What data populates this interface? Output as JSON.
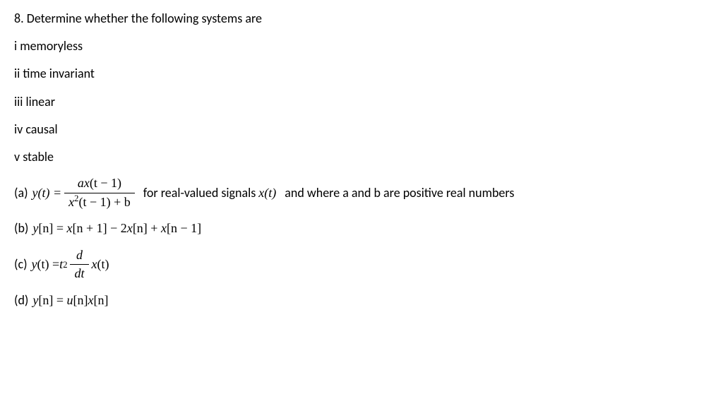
{
  "question": {
    "number": "8.",
    "prompt": "Determine whether the following systems are"
  },
  "properties": {
    "i": "i memoryless",
    "ii": "ii time invariant",
    "iii": "iii linear",
    "iv": "iv causal",
    "v": "v stable"
  },
  "parts": {
    "a": {
      "label": "(a)",
      "lhs": "y(t) =",
      "numerator_a": "ax",
      "numerator_paren": "(t − 1)",
      "denominator_x": "x",
      "denominator_exp": "2",
      "denominator_paren": "(t − 1) + b",
      "trailing_1": "for real-valued signals",
      "trailing_math": "x(t)",
      "trailing_2": "and where a and b are positive real numbers"
    },
    "b": {
      "label": "(b)",
      "expr_y": "y",
      "expr_bracket1": "[n] = ",
      "expr_x1": "x",
      "expr_bracket2": "[n + 1] − 2",
      "expr_x2": "x",
      "expr_bracket3": "[n] + ",
      "expr_x3": "x",
      "expr_bracket4": "[n − 1]"
    },
    "c": {
      "label": "(c)",
      "lhs_y": "y",
      "lhs_paren": "(t) = ",
      "t": "t",
      "exp": "2",
      "frac_num": "d",
      "frac_den": "dt",
      "rhs_x": "x",
      "rhs_paren": "(t)"
    },
    "d": {
      "label": "(d)",
      "expr_y": "y",
      "expr_bracket1": "[n] = ",
      "expr_u": "u",
      "expr_bracket2": "[n]",
      "expr_x": "x",
      "expr_bracket3": "[n]"
    }
  }
}
